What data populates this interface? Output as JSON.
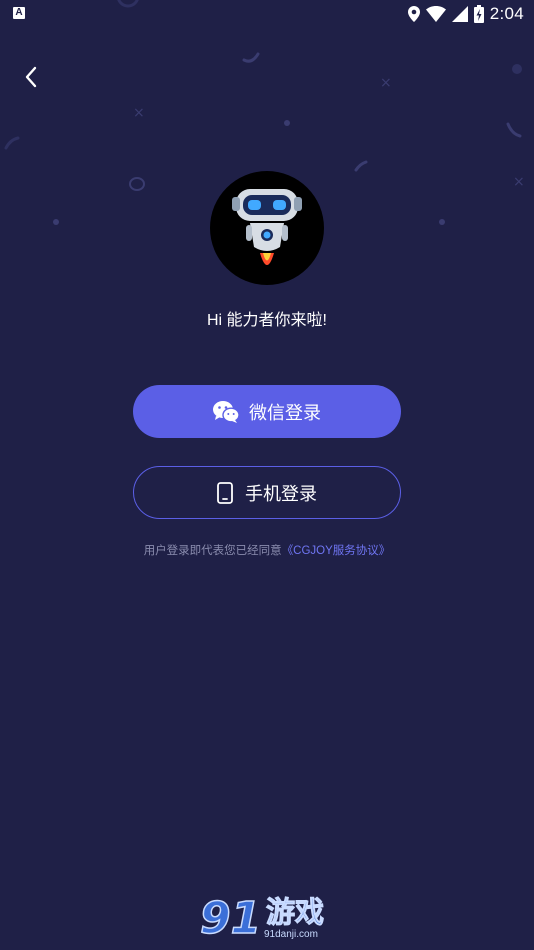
{
  "status_bar": {
    "notification_icon_letter": "A",
    "time": "2:04",
    "icons": [
      "location-icon",
      "wifi-icon",
      "signal-icon",
      "battery-charging-icon"
    ]
  },
  "nav": {
    "back_icon": "chevron-left-icon"
  },
  "greeting": "Hi 能力者你来啦!",
  "buttons": {
    "wechat_label": "微信登录",
    "wechat_icon": "wechat-icon",
    "phone_label": "手机登录",
    "phone_icon": "phone-icon"
  },
  "agreement": {
    "prefix": "用户登录即代表您已经同意",
    "link": "《CGJOY服务协议》"
  },
  "watermark": {
    "number": "91",
    "text": "游戏",
    "domain": "91danji.com"
  },
  "colors": {
    "background": "#1f2047",
    "accent": "#5b5fe6",
    "link": "#6f75f2",
    "muted_text": "#8a8cae"
  }
}
